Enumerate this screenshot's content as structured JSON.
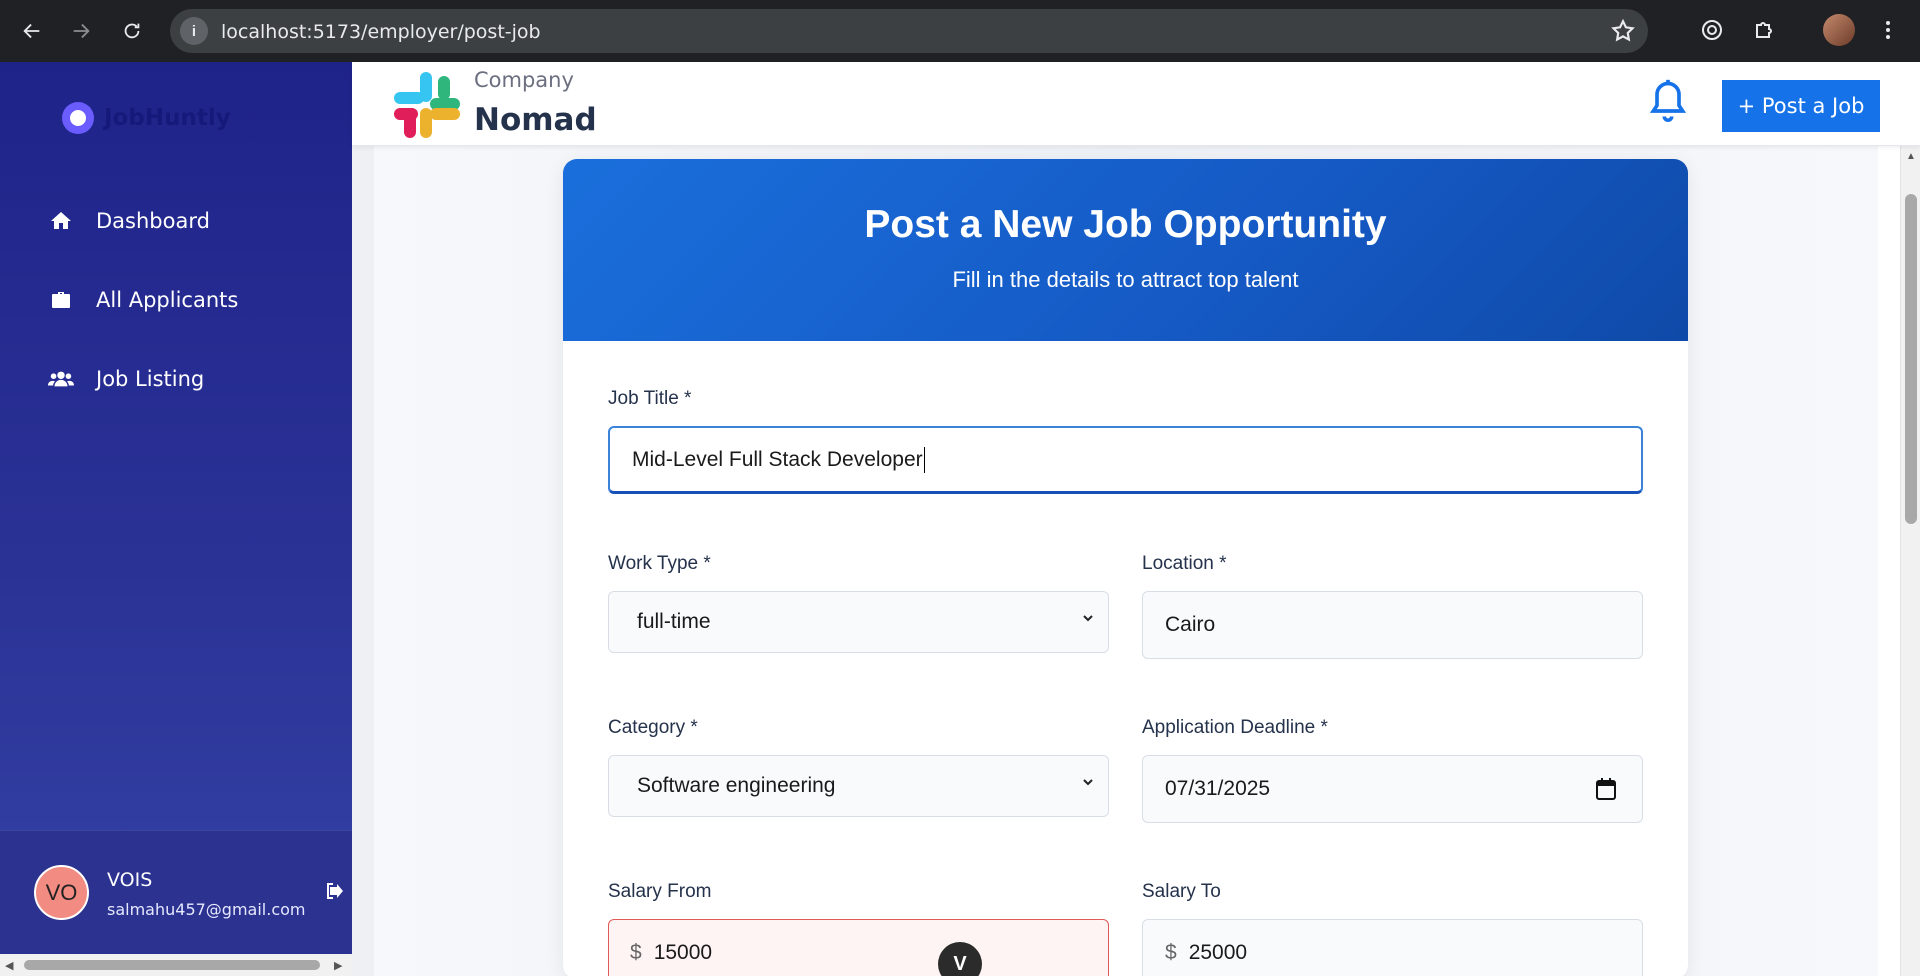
{
  "browser": {
    "url": "localhost:5173/employer/post-job",
    "info_icon": "info-icon",
    "back_icon": "arrow-left-icon",
    "forward_icon": "arrow-right-icon",
    "reload_icon": "reload-icon",
    "bookmark_icon": "star-icon"
  },
  "sidebar": {
    "brand": "JobHuntly",
    "items": [
      {
        "label": "Dashboard",
        "icon": "home-icon"
      },
      {
        "label": "All Applicants",
        "icon": "briefcase-icon"
      },
      {
        "label": "Job Listing",
        "icon": "users-icon"
      }
    ],
    "user": {
      "initials": "VO",
      "name": "VOIS",
      "email": "salmahu457@gmail.com"
    }
  },
  "header": {
    "company_label": "Company",
    "company_name": "Nomad",
    "post_button": "+ Post a Job"
  },
  "form": {
    "title": "Post a New Job Opportunity",
    "subtitle": "Fill in the details to attract top talent",
    "job_title_label": "Job Title *",
    "job_title_value": "Mid-Level Full Stack Developer",
    "work_type_label": "Work Type *",
    "work_type_value": "full-time",
    "location_label": "Location *",
    "location_value": "Cairo",
    "category_label": "Category *",
    "category_value": "Software engineering",
    "deadline_label": "Application Deadline *",
    "deadline_value": "07/31/2025",
    "salary_from_label": "Salary From",
    "salary_from_value": "15000",
    "salary_to_label": "Salary To",
    "salary_to_value": "25000",
    "currency_symbol": "$"
  },
  "scroll_down_glyph": "V",
  "colors": {
    "sidebar_bg": "#1e2389",
    "accent": "#1572e8",
    "card_header": "#1559c4",
    "error_border": "#e05a5a"
  }
}
